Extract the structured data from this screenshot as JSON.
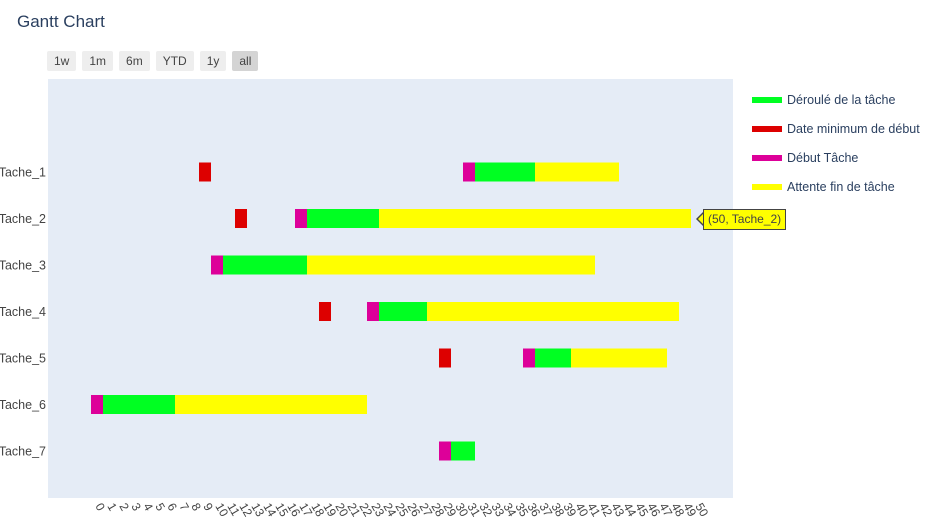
{
  "title": "Gantt Chart",
  "range_buttons": [
    {
      "label": "1w",
      "active": false
    },
    {
      "label": "1m",
      "active": false
    },
    {
      "label": "6m",
      "active": false
    },
    {
      "label": "YTD",
      "active": false
    },
    {
      "label": "1y",
      "active": false
    },
    {
      "label": "all",
      "active": true
    }
  ],
  "legend": [
    {
      "name": "Déroulé de la tâche",
      "color": "#00ff22"
    },
    {
      "name": "Date minimum de début",
      "color": "#dd0000"
    },
    {
      "name": "Début Tâche",
      "color": "#dd0099"
    },
    {
      "name": "Attente fin de tâche",
      "color": "#ffff00"
    }
  ],
  "tooltip": {
    "text": "(50, Tache_2)"
  },
  "chart_data": {
    "type": "bar",
    "orientation": "horizontal",
    "title": "Gantt Chart",
    "xlim": [
      -4,
      53
    ],
    "x_ticks": [
      0,
      1,
      2,
      3,
      4,
      5,
      6,
      7,
      8,
      9,
      10,
      11,
      12,
      13,
      14,
      15,
      16,
      17,
      18,
      19,
      20,
      21,
      22,
      23,
      24,
      25,
      26,
      27,
      28,
      29,
      30,
      31,
      32,
      33,
      34,
      35,
      36,
      37,
      38,
      39,
      40,
      41,
      42,
      43,
      44,
      45,
      46,
      47,
      48,
      49,
      50
    ],
    "grid": false,
    "plot_bgcolor": "#e5ecf6",
    "legend_position": "right",
    "tasks": [
      {
        "name": "Tache_1",
        "min_start": [
          9,
          10
        ],
        "start": [
          31,
          32
        ],
        "run": [
          32,
          37
        ],
        "wait": [
          37,
          44
        ]
      },
      {
        "name": "Tache_2",
        "min_start": [
          12,
          13
        ],
        "start": [
          17,
          18
        ],
        "run": [
          18,
          24
        ],
        "wait": [
          24,
          50
        ]
      },
      {
        "name": "Tache_3",
        "min_start": null,
        "start": [
          10,
          11
        ],
        "run": [
          11,
          18
        ],
        "wait": [
          18,
          42
        ]
      },
      {
        "name": "Tache_4",
        "min_start": [
          19,
          20
        ],
        "start": [
          23,
          24
        ],
        "run": [
          24,
          28
        ],
        "wait": [
          28,
          49
        ]
      },
      {
        "name": "Tache_5",
        "min_start": [
          29,
          30
        ],
        "start": [
          36,
          37
        ],
        "run": [
          37,
          40
        ],
        "wait": [
          40,
          48
        ]
      },
      {
        "name": "Tache_6",
        "min_start": null,
        "start": [
          0,
          1
        ],
        "run": [
          1,
          7
        ],
        "wait": [
          7,
          23
        ]
      },
      {
        "name": "Tache_7",
        "min_start": null,
        "start": [
          29,
          30
        ],
        "run": [
          30,
          32
        ],
        "wait": null
      }
    ]
  }
}
